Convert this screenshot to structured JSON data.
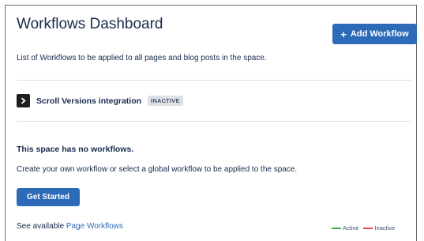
{
  "header": {
    "title": "Workflows Dashboard",
    "add_button_label": "Add Workflow",
    "description": "List of Workflows to be applied to all pages and blog posts in the space."
  },
  "integration": {
    "name": "Scroll Versions integration",
    "status": "INACTIVE"
  },
  "empty_state": {
    "heading": "This space has no workflows.",
    "text": "Create your own workflow or select a global workflow to be applied to the space.",
    "button_label": "Get Started"
  },
  "footer": {
    "prefix": "See available",
    "link_label": "Page Workflows"
  },
  "legend": {
    "active_label": "Active",
    "inactive_label": "Inactive"
  },
  "colors": {
    "accent": "#2d6bb8",
    "active": "#3fae49",
    "inactive": "#e5484d"
  }
}
